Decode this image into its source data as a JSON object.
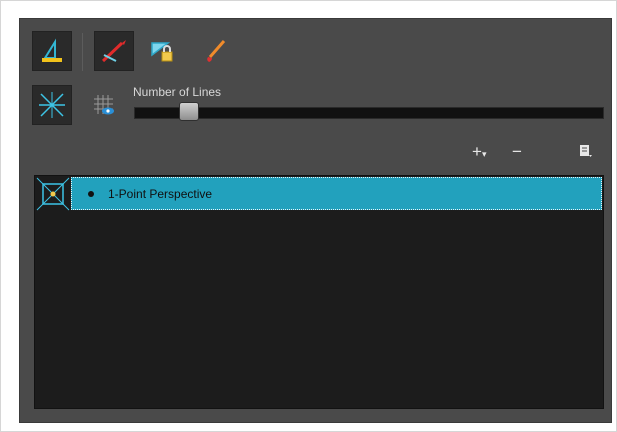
{
  "toolbar": {
    "ruler_tool": "ruler-icon",
    "draw_tool": "pencil-ruler-icon",
    "lock_tool": "ruler-lock-icon",
    "paint_tool": "brush-icon",
    "perspective_tool": "perspective-lines-icon",
    "grid_visibility_tool": "grid-eye-icon"
  },
  "slider": {
    "label": "Number of Lines",
    "value_fraction": 0.1
  },
  "list_controls": {
    "add_label": "+",
    "remove_label": "−",
    "menu_icon": "menu-icon"
  },
  "guides": [
    {
      "name": "1-Point Perspective",
      "selected": true
    }
  ],
  "colors": {
    "panel_bg": "#4a4a4a",
    "list_bg": "#1c1c1c",
    "selection": "#22a1bd"
  }
}
